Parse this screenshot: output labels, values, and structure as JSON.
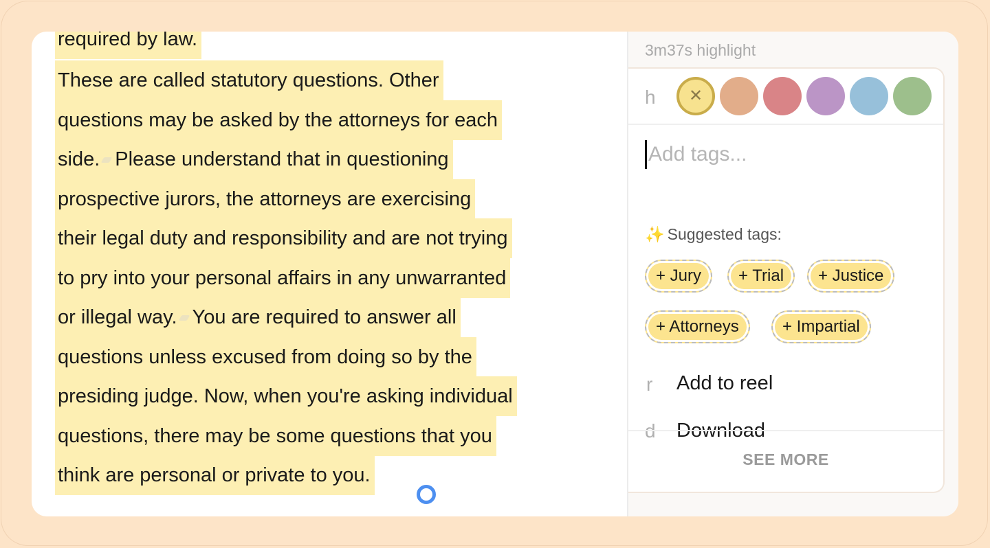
{
  "transcript": {
    "partial_top_line": "required by law.",
    "lines": [
      {
        "text": "These are called statutory questions. Other"
      },
      {
        "text": "questions may be asked by the attorneys for each"
      },
      {
        "pre": "side.",
        "post": "Please understand that in questioning"
      },
      {
        "text": "prospective jurors, the attorneys are exercising"
      },
      {
        "text": "their legal duty and responsibility and are not trying"
      },
      {
        "text": "to pry into your personal affairs in any unwarranted"
      },
      {
        "pre": "or illegal way.",
        "post": "You are required to answer all"
      },
      {
        "text": "questions unless excused from doing so by the"
      },
      {
        "text": "presiding judge. Now, when you're asking individual"
      },
      {
        "text": "questions, there may be some questions that you"
      },
      {
        "text": "think are personal or private to you."
      }
    ]
  },
  "panel": {
    "header": "3m37s highlight",
    "color_hotkey": "h",
    "colors": [
      {
        "name": "yellow",
        "hex": "#f7e28f",
        "active": true,
        "glyph": "✕"
      },
      {
        "name": "peach",
        "hex": "#e2ad8a"
      },
      {
        "name": "red",
        "hex": "#d98487"
      },
      {
        "name": "purple",
        "hex": "#bb95c6"
      },
      {
        "name": "blue",
        "hex": "#97c0da"
      },
      {
        "name": "green",
        "hex": "#9dbf8c"
      }
    ],
    "tag_placeholder": "Add tags...",
    "suggested_label": "Suggested tags:",
    "suggested_tags": [
      "+ Jury",
      "+ Trial",
      "+ Justice",
      "+ Attorneys",
      "+ Impartial"
    ],
    "actions": [
      {
        "hotkey": "r",
        "label": "Add to reel"
      },
      {
        "hotkey": "d",
        "label": "Download"
      }
    ],
    "see_more": "SEE MORE"
  }
}
